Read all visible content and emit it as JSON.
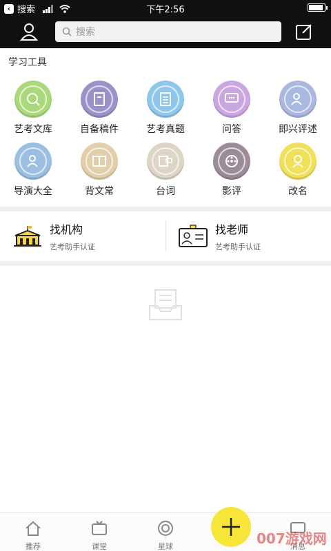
{
  "status_bar": {
    "back_app": "搜索",
    "time": "下午2:56"
  },
  "header": {
    "search_placeholder": "搜索"
  },
  "section_title": "学习工具",
  "tools": [
    {
      "label": "艺考文库",
      "color": "#a9d97a",
      "icon": "book-search-icon"
    },
    {
      "label": "自备稿件",
      "color": "#9c92c9",
      "icon": "notebook-icon"
    },
    {
      "label": "艺考真题",
      "color": "#8fc7ec",
      "icon": "document-icon"
    },
    {
      "label": "问答",
      "color": "#c9a6e0",
      "icon": "chat-icon"
    },
    {
      "label": "即兴评述",
      "color": "#a8b8df",
      "icon": "speaker-icon"
    },
    {
      "label": "导演大全",
      "color": "#9bbfe0",
      "icon": "director-icon"
    },
    {
      "label": "背文常",
      "color": "#e2cfa9",
      "icon": "art-book-icon"
    },
    {
      "label": "台词",
      "color": "#ddd6c4",
      "icon": "script-icon"
    },
    {
      "label": "影评",
      "color": "#9c8c9a",
      "icon": "film-reel-icon"
    },
    {
      "label": "改名",
      "color": "#f1e05a",
      "icon": "name-badge-icon"
    }
  ],
  "find_institution": {
    "title": "找机构",
    "subtitle": "艺考助手认证"
  },
  "find_teacher": {
    "title": "找老师",
    "subtitle": "艺考助手认证"
  },
  "tabbar": [
    {
      "label": "推荐",
      "icon": "home-icon"
    },
    {
      "label": "课堂",
      "icon": "tv-icon"
    },
    {
      "label": "星球",
      "icon": "planet-icon"
    },
    {
      "label": "消息",
      "icon": "message-icon"
    }
  ],
  "watermark": "007游戏网"
}
